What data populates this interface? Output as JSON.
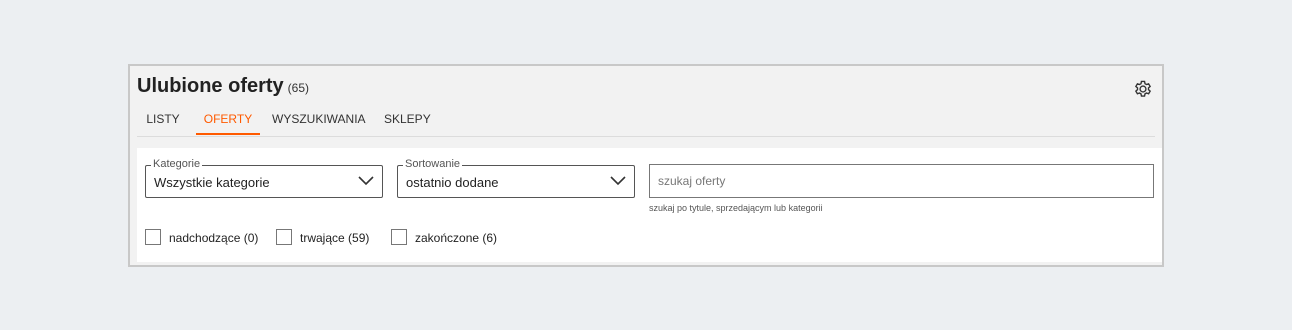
{
  "header": {
    "title": "Ulubione oferty",
    "count": "(65)"
  },
  "icons": {
    "settings": "gear-icon",
    "dropdown": "chevron-down-icon"
  },
  "colors": {
    "accent": "#ff5a00",
    "panel_border": "#c8c8c8",
    "background": "#eceff2"
  },
  "tabs": [
    {
      "label": "LISTY",
      "active": false
    },
    {
      "label": "OFERTY",
      "active": true
    },
    {
      "label": "WYSZUKIWANIA",
      "active": false
    },
    {
      "label": "SKLEPY",
      "active": false
    }
  ],
  "filters": {
    "category": {
      "legend": "Kategorie",
      "value": "Wszystkie kategorie"
    },
    "sort": {
      "legend": "Sortowanie",
      "value": "ostatnio dodane"
    },
    "search": {
      "placeholder": "szukaj oferty",
      "value": "",
      "hint": "szukaj po tytule, sprzedającym lub kategorii"
    }
  },
  "status_filters": [
    {
      "label": "nadchodzące  (0)",
      "checked": false
    },
    {
      "label": "trwające  (59)",
      "checked": false
    },
    {
      "label": "zakończone  (6)",
      "checked": false
    }
  ]
}
